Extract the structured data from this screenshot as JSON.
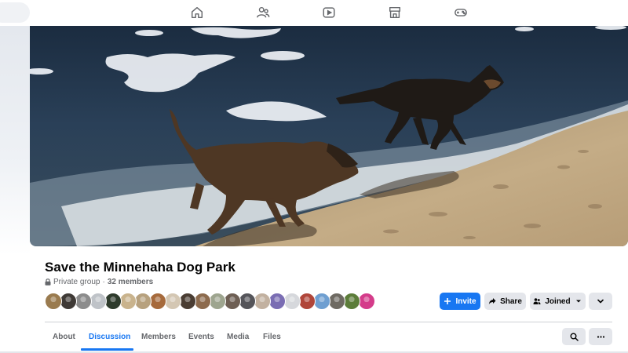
{
  "nav": {
    "icons": [
      "home-icon",
      "friends-icon",
      "video-icon",
      "marketplace-icon",
      "gaming-icon"
    ]
  },
  "group": {
    "title": "Save the Minnehaha Dog Park",
    "privacy": "Private group",
    "separator": "·",
    "members": "32 members"
  },
  "member_avatars": [
    {
      "color": "#9a7b4f"
    },
    {
      "color": "#3f3a36"
    },
    {
      "color": "#8c8c8c"
    },
    {
      "color": "#bfc3c8"
    },
    {
      "color": "#2e3b2c"
    },
    {
      "color": "#c9b38d"
    },
    {
      "color": "#b7a17e"
    },
    {
      "color": "#a66a3c"
    },
    {
      "color": "#d4c7b3"
    },
    {
      "color": "#4a3d33"
    },
    {
      "color": "#8d6b4e"
    },
    {
      "color": "#9ea58f"
    },
    {
      "color": "#6e5f54"
    },
    {
      "color": "#55555a"
    },
    {
      "color": "#c2b1a0"
    },
    {
      "color": "#7a6db3"
    },
    {
      "color": "#d6d8dc"
    },
    {
      "color": "#b0463a"
    },
    {
      "color": "#6f9fd1"
    },
    {
      "color": "#6e6a62"
    },
    {
      "color": "#5c7d3a"
    },
    {
      "color": "#d43c8a"
    }
  ],
  "actions": {
    "invite": "Invite",
    "share": "Share",
    "joined": "Joined"
  },
  "tabs": [
    {
      "label": "About"
    },
    {
      "label": "Discussion",
      "active": true
    },
    {
      "label": "Members"
    },
    {
      "label": "Events"
    },
    {
      "label": "Media"
    },
    {
      "label": "Files"
    }
  ],
  "colors": {
    "accent": "#1877f2",
    "button_gray": "#e4e6eb",
    "secondary_text": "#65676b"
  }
}
